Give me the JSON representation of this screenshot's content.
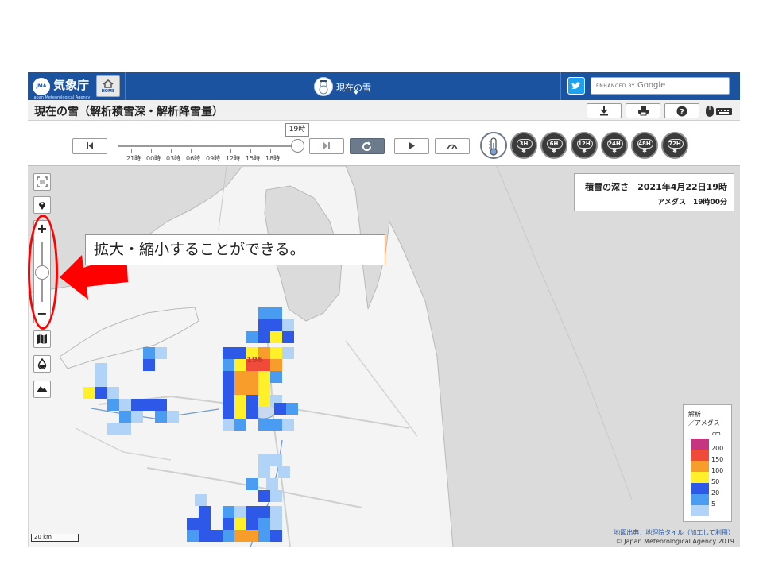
{
  "header": {
    "logo_jp": "気象庁",
    "logo_en": "Japan Meteorological Agency",
    "logo_mark": "JMA",
    "home_label": "HOME",
    "app_title": "現在の雪",
    "search_prefix": "ENHANCED BY",
    "search_brand": "Google"
  },
  "page": {
    "title": "現在の雪（解析積雪深・解析降雪量）"
  },
  "timeline": {
    "current_badge": "19時",
    "labels": [
      "21時",
      "00時",
      "03時",
      "06時",
      "09時",
      "12時",
      "15時",
      "18時"
    ],
    "period_buttons": [
      "3H",
      "6H",
      "12H",
      "24H",
      "48H",
      "72H"
    ]
  },
  "map": {
    "annotation": "拡大・縮小することができる。",
    "info_title": "積雪の深さ　2021年4月22日19時",
    "info_sub": "アメダス　19時00分",
    "point_value": "196",
    "scale": "20 km",
    "credit": "地図出典：地理院タイル（加工して利用）",
    "copyright": "© Japan Meteorological Agency 2019"
  },
  "legend": {
    "title_line1": "解析",
    "title_line2": "／アメダス",
    "unit": "cm",
    "items": [
      {
        "label": "200",
        "color": "#c6357f"
      },
      {
        "label": "150",
        "color": "#f04a3a"
      },
      {
        "label": "100",
        "color": "#f89d2c"
      },
      {
        "label": "50",
        "color": "#fff02a"
      },
      {
        "label": "20",
        "color": "#2e58e8"
      },
      {
        "label": "5",
        "color": "#4a9cf2"
      },
      {
        "label": "",
        "color": "#b0d3f7"
      }
    ]
  },
  "colors": {
    "header_bg": "#1b53a0",
    "annotation_red": "#ff0000",
    "callout_border": "#e0803a"
  }
}
